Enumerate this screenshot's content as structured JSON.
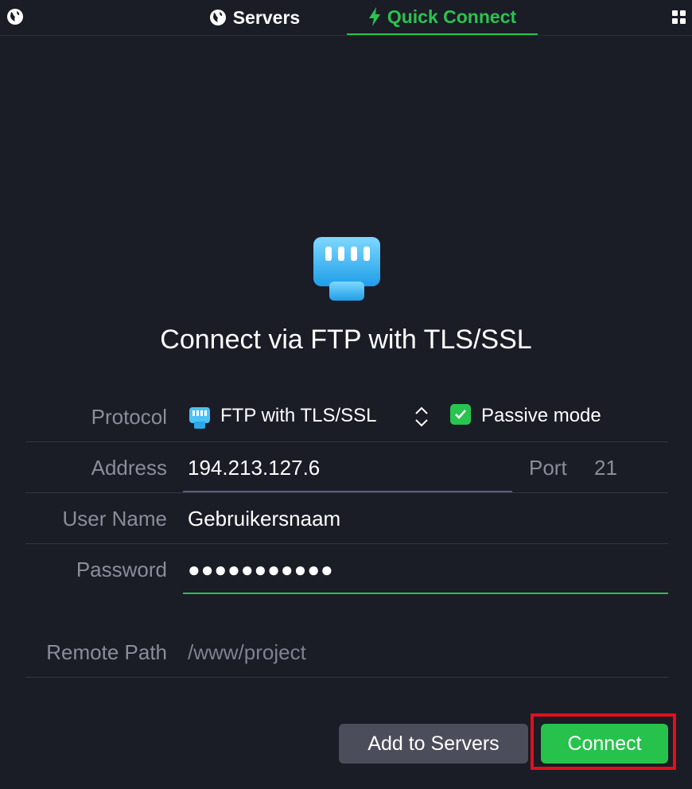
{
  "tabs": {
    "servers_label": "Servers",
    "quick_connect_label": "Quick Connect",
    "active": "quick_connect"
  },
  "hero": {
    "title": "Connect via FTP with TLS/SSL",
    "icon": "ethernet-port-icon"
  },
  "form": {
    "protocol": {
      "label": "Protocol",
      "value": "FTP with TLS/SSL",
      "passive_label": "Passive mode",
      "passive_checked": true
    },
    "address": {
      "label": "Address",
      "value": "194.213.127.6",
      "port_label": "Port",
      "port_value": "21"
    },
    "username": {
      "label": "User Name",
      "value": "Gebruikersnaam"
    },
    "password": {
      "label": "Password",
      "value": "●●●●●●●●●●●"
    },
    "remote_path": {
      "label": "Remote Path",
      "value": "/www/project"
    }
  },
  "buttons": {
    "add_to_servers": "Add to Servers",
    "connect": "Connect"
  },
  "colors": {
    "background": "#1a1c26",
    "accent": "#29c450",
    "highlight": "#e0101c"
  }
}
